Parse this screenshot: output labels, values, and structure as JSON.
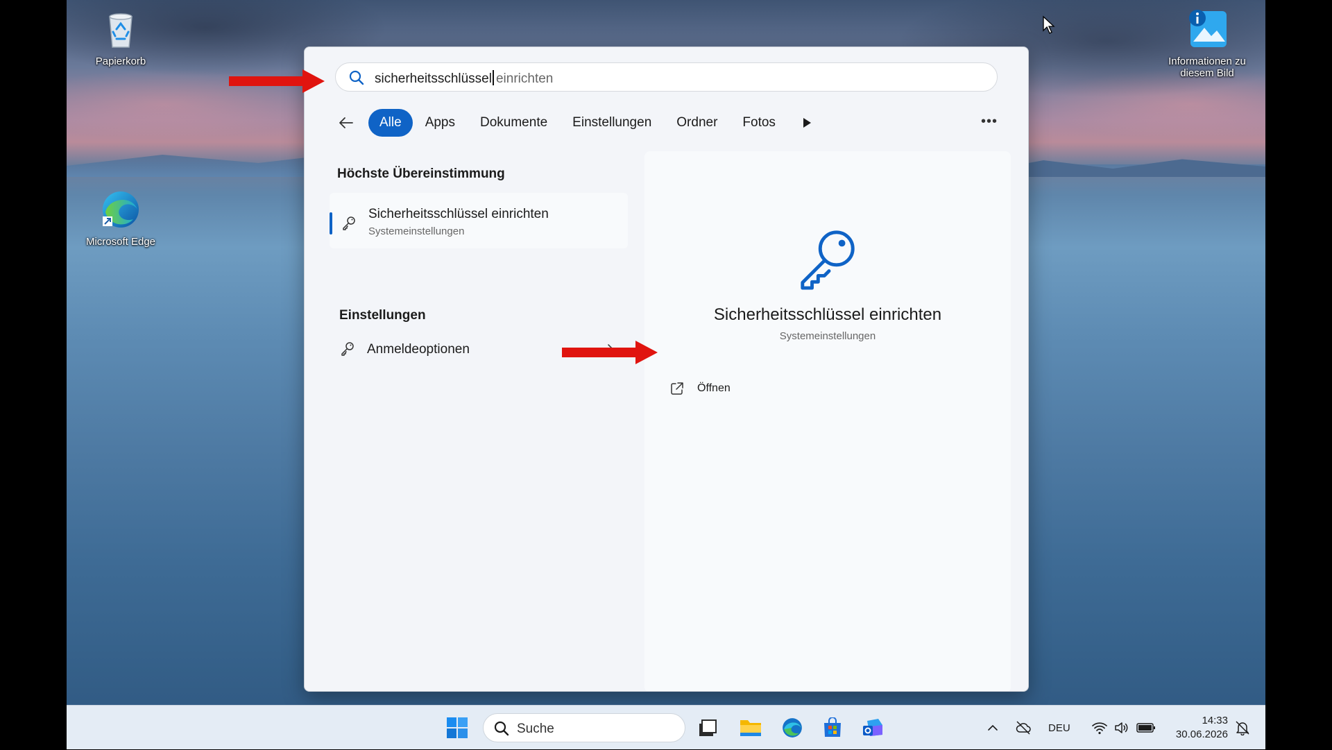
{
  "desktop": {
    "icons": [
      {
        "label": "Papierkorb",
        "icon": "recycle-bin-icon"
      },
      {
        "label": "Microsoft Edge",
        "icon": "edge-icon"
      },
      {
        "label": "Informationen zu diesem Bild",
        "icon": "picture-info-icon"
      }
    ]
  },
  "search": {
    "typed_text": "sicherheitsschlüssel",
    "suggestion_text": "einrichten",
    "filters": [
      "Alle",
      "Apps",
      "Dokumente",
      "Einstellungen",
      "Ordner",
      "Fotos"
    ],
    "active_filter": "Alle",
    "best_match_heading": "Höchste Übereinstimmung",
    "best_match": {
      "title": "Sicherheitsschlüssel einrichten",
      "subtitle": "Systemeinstellungen",
      "icon": "key-icon"
    },
    "settings_heading": "Einstellungen",
    "settings_items": [
      {
        "label": "Anmeldeoptionen",
        "icon": "key-icon"
      }
    ],
    "detail": {
      "title": "Sicherheitsschlüssel einrichten",
      "subtitle": "Systemeinstellungen",
      "action_label": "Öffnen",
      "action_icon": "open-external-icon"
    }
  },
  "taskbar": {
    "search_placeholder": "Suche",
    "apps": [
      "start-icon",
      "task-view-icon",
      "file-explorer-icon",
      "edge-icon",
      "microsoft-store-icon",
      "outlook-icon"
    ],
    "language": "DEU",
    "time": "14:33",
    "date": "30.06.2026"
  },
  "colors": {
    "accent": "#0f63c6",
    "annotation_arrow": "#e0140f"
  }
}
